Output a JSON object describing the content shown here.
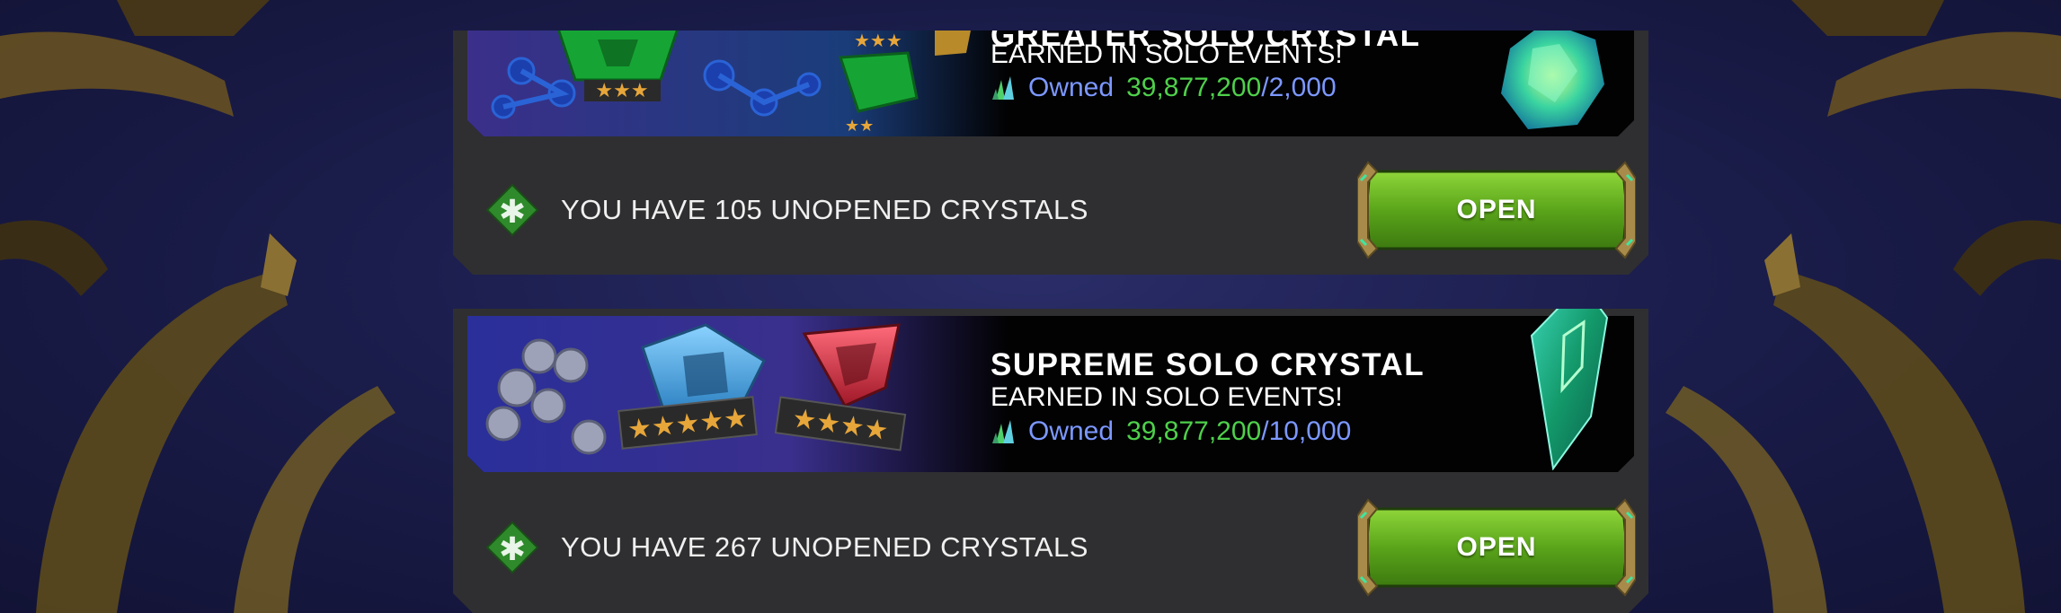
{
  "crystals": [
    {
      "title": "GREATER SOLO CRYSTAL",
      "subtitle": "EARNED IN SOLO EVENTS!",
      "owned_label": "Owned",
      "owned_amount": "39,877,200",
      "separator": "/",
      "cost": "2,000",
      "unopened_text": "YOU HAVE 105 UNOPENED CRYSTALS",
      "button_label": "OPEN"
    },
    {
      "title": "SUPREME SOLO CRYSTAL",
      "subtitle": "EARNED IN SOLO EVENTS!",
      "owned_label": "Owned",
      "owned_amount": "39,877,200",
      "separator": "/",
      "cost": "10,000",
      "unopened_text": "YOU HAVE 267 UNOPENED CRYSTALS",
      "button_label": "OPEN"
    }
  ],
  "colors": {
    "owned_amount": "#4fd04b",
    "owned_label": "#7c98ff",
    "button_green": "#5aa51a",
    "card_bg": "#2f2f31"
  },
  "icons": [
    "solo-shard-icon",
    "green-star-badge-icon",
    "greater-crystal-icon",
    "supreme-crystal-icon"
  ]
}
